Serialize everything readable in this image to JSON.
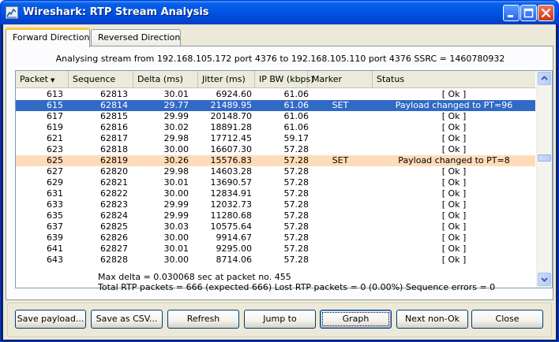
{
  "window": {
    "title": "Wireshark: RTP Stream Analysis"
  },
  "title_buttons": {
    "minimize": "minimize-icon",
    "maximize": "maximize-icon",
    "close": "close-icon"
  },
  "tabs": [
    {
      "label": "Forward Direction",
      "active": true
    },
    {
      "label": "Reversed Direction",
      "active": false
    }
  ],
  "analysing": "Analysing stream from  192.168.105.172 port 4376  to  192.168.105.110 port 4376   SSRC = 1460780932",
  "table": {
    "columns": [
      "Packet",
      "Sequence",
      "Delta (ms)",
      "Jitter (ms)",
      "IP BW (kbps)",
      "Marker",
      "Status"
    ],
    "sort_indicator": "▼",
    "rows": [
      {
        "packet": "613",
        "seq": "62813",
        "delta": "30.01",
        "jitter": "6924.60",
        "bw": "61.06",
        "marker": "",
        "status": "[ Ok ]"
      },
      {
        "packet": "615",
        "seq": "62814",
        "delta": "29.77",
        "jitter": "21489.95",
        "bw": "61.06",
        "marker": "SET",
        "status": "Payload changed to PT=96"
      },
      {
        "packet": "617",
        "seq": "62815",
        "delta": "29.99",
        "jitter": "20148.70",
        "bw": "61.06",
        "marker": "",
        "status": "[ Ok ]"
      },
      {
        "packet": "619",
        "seq": "62816",
        "delta": "30.02",
        "jitter": "18891.28",
        "bw": "61.06",
        "marker": "",
        "status": "[ Ok ]"
      },
      {
        "packet": "621",
        "seq": "62817",
        "delta": "29.98",
        "jitter": "17712.45",
        "bw": "59.17",
        "marker": "",
        "status": "[ Ok ]"
      },
      {
        "packet": "623",
        "seq": "62818",
        "delta": "30.00",
        "jitter": "16607.30",
        "bw": "57.28",
        "marker": "",
        "status": "[ Ok ]"
      },
      {
        "packet": "625",
        "seq": "62819",
        "delta": "30.26",
        "jitter": "15576.83",
        "bw": "57.28",
        "marker": "SET",
        "status": "Payload changed to PT=8"
      },
      {
        "packet": "627",
        "seq": "62820",
        "delta": "29.98",
        "jitter": "14603.28",
        "bw": "57.28",
        "marker": "",
        "status": "[ Ok ]"
      },
      {
        "packet": "629",
        "seq": "62821",
        "delta": "30.01",
        "jitter": "13690.57",
        "bw": "57.28",
        "marker": "",
        "status": "[ Ok ]"
      },
      {
        "packet": "631",
        "seq": "62822",
        "delta": "30.00",
        "jitter": "12834.91",
        "bw": "57.28",
        "marker": "",
        "status": "[ Ok ]"
      },
      {
        "packet": "633",
        "seq": "62823",
        "delta": "29.99",
        "jitter": "12032.73",
        "bw": "57.28",
        "marker": "",
        "status": "[ Ok ]"
      },
      {
        "packet": "635",
        "seq": "62824",
        "delta": "29.99",
        "jitter": "11280.68",
        "bw": "57.28",
        "marker": "",
        "status": "[ Ok ]"
      },
      {
        "packet": "637",
        "seq": "62825",
        "delta": "30.03",
        "jitter": "10575.64",
        "bw": "57.28",
        "marker": "",
        "status": "[ Ok ]"
      },
      {
        "packet": "639",
        "seq": "62826",
        "delta": "30.00",
        "jitter": "9914.67",
        "bw": "57.28",
        "marker": "",
        "status": "[ Ok ]"
      },
      {
        "packet": "641",
        "seq": "62827",
        "delta": "30.01",
        "jitter": "9295.00",
        "bw": "57.28",
        "marker": "",
        "status": "[ Ok ]"
      },
      {
        "packet": "643",
        "seq": "62828",
        "delta": "30.00",
        "jitter": "8714.06",
        "bw": "57.28",
        "marker": "",
        "status": "[ Ok ]"
      }
    ],
    "selected_row": 1,
    "marked_row": 6,
    "colors": {
      "selected_bg": "#316ac5",
      "marked_bg": "#ffdcb9"
    }
  },
  "stats": {
    "max_delta": "Max delta = 0.030068 sec at packet no. 455",
    "totals": "Total RTP packets = 666   (expected 666)   Lost RTP packets = 0 (0.00%)   Sequence errors = 0"
  },
  "buttons": {
    "save_payload": "Save payload...",
    "save_csv": "Save as CSV...",
    "refresh": "Refresh",
    "jump_to": "Jump to",
    "graph": "Graph",
    "next_non_ok": "Next non-Ok",
    "close": "Close"
  },
  "colors": {
    "titlebar": "#0055e5",
    "dialog_bg": "#ece9d8",
    "active_tab_accent": "#ffc83c"
  }
}
